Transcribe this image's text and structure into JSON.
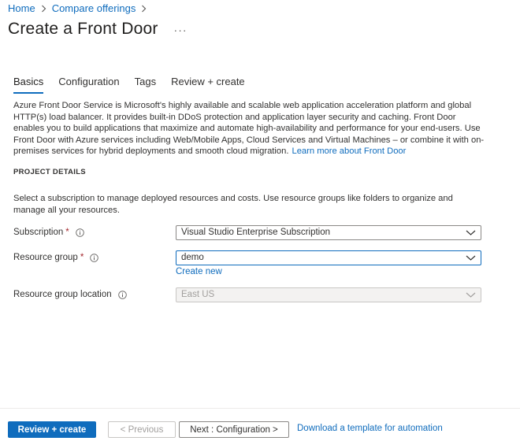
{
  "breadcrumb": {
    "home": "Home",
    "compare": "Compare offerings"
  },
  "header": {
    "title": "Create a Front Door",
    "more": "···"
  },
  "tabs": [
    {
      "label": "Basics",
      "active": true
    },
    {
      "label": "Configuration",
      "active": false
    },
    {
      "label": "Tags",
      "active": false
    },
    {
      "label": "Review + create",
      "active": false
    }
  ],
  "intro": {
    "text": "Azure Front Door Service is Microsoft's highly available and scalable web application acceleration platform and global HTTP(s) load balancer. It provides built-in DDoS protection and application layer security and caching. Front Door enables you to build applications that maximize and automate high-availability and performance for your end-users. Use Front Door with Azure services including Web/Mobile Apps, Cloud Services and Virtual Machines – or combine it with on-premises services for hybrid deployments and smooth cloud migration.",
    "link": "Learn more about Front Door"
  },
  "project_details": {
    "heading": "PROJECT DETAILS",
    "description": "Select a subscription to manage deployed resources and costs. Use resource groups like folders to organize and manage all your resources."
  },
  "form": {
    "subscription": {
      "label": "Subscription",
      "required": "*",
      "value": "Visual Studio Enterprise Subscription"
    },
    "resource_group": {
      "label": "Resource group",
      "required": "*",
      "value": "demo",
      "create_new": "Create new"
    },
    "location": {
      "label": "Resource group location",
      "value": "East US"
    }
  },
  "footer": {
    "review_create": "Review + create",
    "previous": "< Previous",
    "next": "Next : Configuration >",
    "download": "Download a template for automation"
  },
  "colors": {
    "accent": "#0f6cbd",
    "required": "#a4262c",
    "text": "#323130"
  },
  "icons": {
    "breadcrumb_separator": "chevron-right-icon",
    "info": "info-icon",
    "dropdown": "chevron-down-icon"
  }
}
